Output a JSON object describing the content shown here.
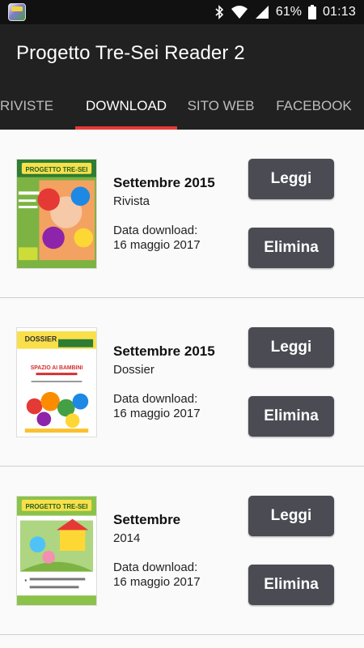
{
  "status": {
    "battery": "61%",
    "time": "01:13",
    "icons": [
      "app-icon",
      "bluetooth-icon",
      "wifi-icon",
      "signal-icon",
      "battery-icon"
    ]
  },
  "app": {
    "title": "Progetto Tre-Sei Reader 2"
  },
  "tabs": [
    {
      "label": "RIVISTE",
      "active": false
    },
    {
      "label": "DOWNLOAD",
      "active": true
    },
    {
      "label": "SITO WEB",
      "active": false
    },
    {
      "label": "FACEBOOK",
      "active": false
    }
  ],
  "accent": "#e53935",
  "button_color": "#4a4b53",
  "items": [
    {
      "title": "Settembre 2015",
      "type": "Rivista",
      "download_label": "Data download:",
      "download_date": "16 maggio 2017",
      "read_label": "Leggi",
      "delete_label": "Elimina",
      "cover_title": "PROGETTO TRE-SEI"
    },
    {
      "title": "Settembre 2015",
      "type": "Dossier",
      "download_label": "Data download:",
      "download_date": "16 maggio 2017",
      "read_label": "Leggi",
      "delete_label": "Elimina",
      "cover_title": "DOSSIER",
      "cover_subtitle": "SPAZIO AI BAMBINI"
    },
    {
      "title": "Settembre",
      "type": "2014",
      "download_label": "Data download:",
      "download_date": "16 maggio 2017",
      "read_label": "Leggi",
      "delete_label": "Elimina",
      "cover_title": "PROGETTO TRE-SEI"
    }
  ]
}
